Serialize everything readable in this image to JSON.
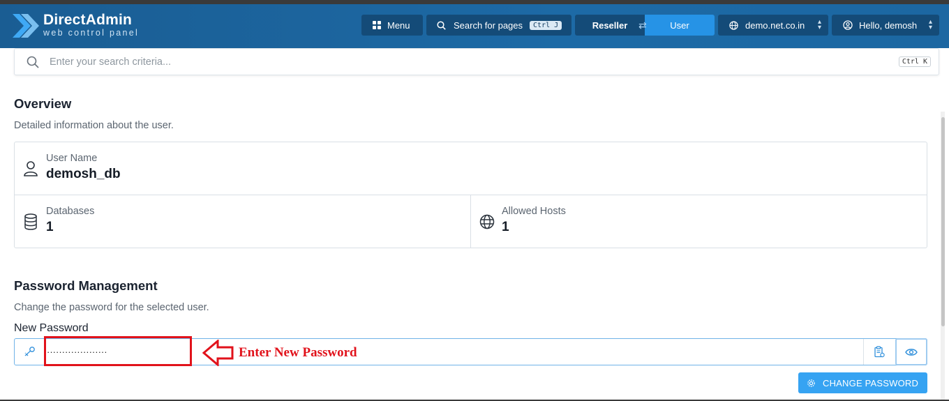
{
  "brand": {
    "name": "DirectAdmin",
    "tagline": "web control panel"
  },
  "header": {
    "menu_label": "Menu",
    "search_pages_label": "Search for pages",
    "search_pages_shortcut": "Ctrl J",
    "switch_reseller": "Reseller",
    "switch_user": "User",
    "domain": "demo.net.co.in",
    "greeting": "Hello, demosh"
  },
  "search": {
    "placeholder": "Enter your search criteria...",
    "shortcut": "Ctrl K"
  },
  "overview": {
    "title": "Overview",
    "description": "Detailed information about the user.",
    "user_name_label": "User Name",
    "user_name_value": "demosh_db",
    "databases_label": "Databases",
    "databases_value": "1",
    "allowed_hosts_label": "Allowed Hosts",
    "allowed_hosts_value": "1"
  },
  "password": {
    "title": "Password Management",
    "description": "Change the password for the selected user.",
    "field_label": "New Password",
    "field_value": "····················",
    "annotation": "Enter New Password",
    "change_button": "CHANGE PASSWORD"
  },
  "colors": {
    "header_bg": "#1d6aa6",
    "header_button": "#144b78",
    "active_switch": "#2693e6",
    "primary_button": "#36a3f2",
    "annotation": "#e1121b"
  }
}
